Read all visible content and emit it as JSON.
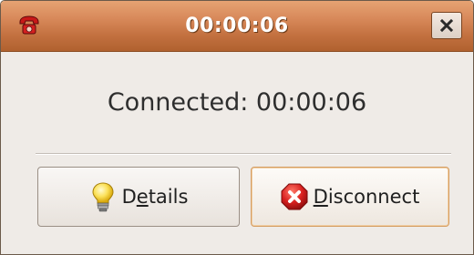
{
  "window": {
    "title": "00:00:06",
    "app_icon": "telephone-icon",
    "close_icon": "close-icon"
  },
  "status": {
    "text": "Connected: 00:00:06"
  },
  "buttons": {
    "details": {
      "label_pre": "D",
      "label_mnemonic": "e",
      "label_post": "tails",
      "icon": "lightbulb-icon"
    },
    "disconnect": {
      "label_pre": "",
      "label_mnemonic": "D",
      "label_post": "isconnect",
      "icon": "stop-icon"
    }
  },
  "colors": {
    "titlebar": "#c97a48",
    "window_bg": "#efebe7",
    "focus_border": "#d59d62",
    "stop_red": "#d8201f"
  }
}
